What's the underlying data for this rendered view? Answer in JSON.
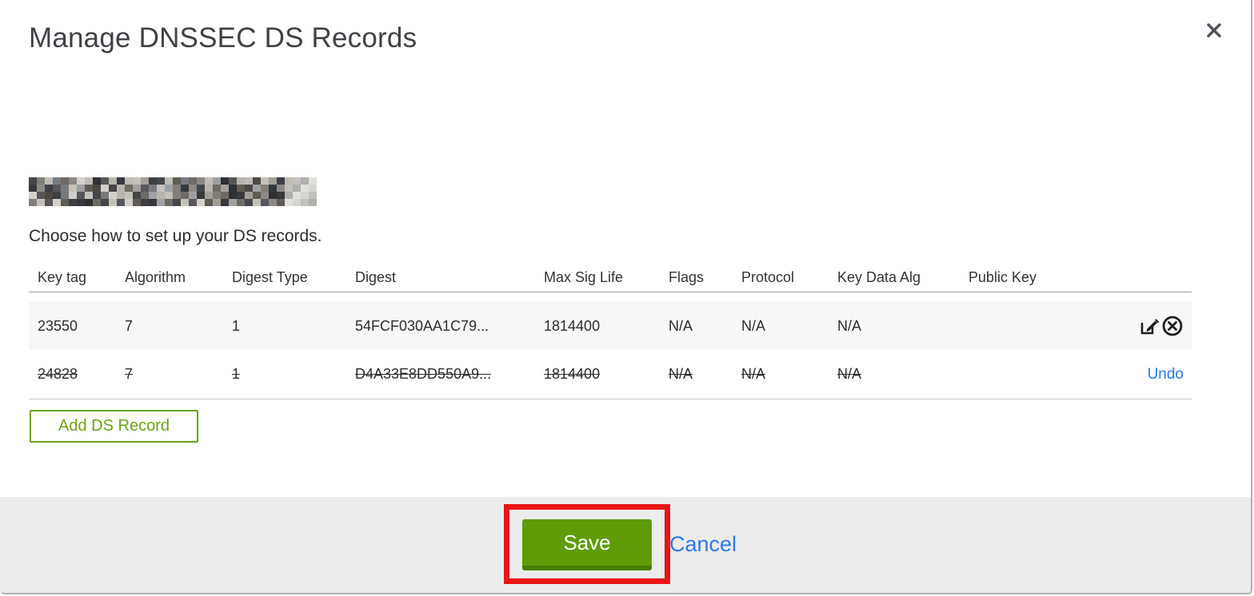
{
  "modal": {
    "title": "Manage DNSSEC DS Records"
  },
  "instructions": "Choose how to set up your DS records.",
  "table": {
    "columns": [
      "Key tag",
      "Algorithm",
      "Digest Type",
      "Digest",
      "Max Sig Life",
      "Flags",
      "Protocol",
      "Key Data Alg",
      "Public Key"
    ],
    "rows": [
      {
        "key_tag": "23550",
        "algorithm": "7",
        "digest_type": "1",
        "digest": "54FCF030AA1C79...",
        "max_sig_life": "1814400",
        "flags": "N/A",
        "protocol": "N/A",
        "key_data_alg": "N/A",
        "public_key": "",
        "state": "active",
        "actions": [
          "edit",
          "delete"
        ]
      },
      {
        "key_tag": "24828",
        "algorithm": "7",
        "digest_type": "1",
        "digest": "D4A33E8DD550A9...",
        "max_sig_life": "1814400",
        "flags": "N/A",
        "protocol": "N/A",
        "key_data_alg": "N/A",
        "public_key": "",
        "state": "deleted",
        "undo_label": "Undo"
      }
    ]
  },
  "buttons": {
    "add_ds_record": "Add DS Record",
    "save": "Save",
    "cancel": "Cancel"
  },
  "colors": {
    "accent_green": "#5f9c08",
    "accent_green_dark": "#4a7d05",
    "outline_green": "#6da214",
    "link_blue": "#2e78e6",
    "annotation_red": "#ea1414",
    "row_highlight": "#f7f7f7",
    "footer_bg": "#ececec"
  }
}
